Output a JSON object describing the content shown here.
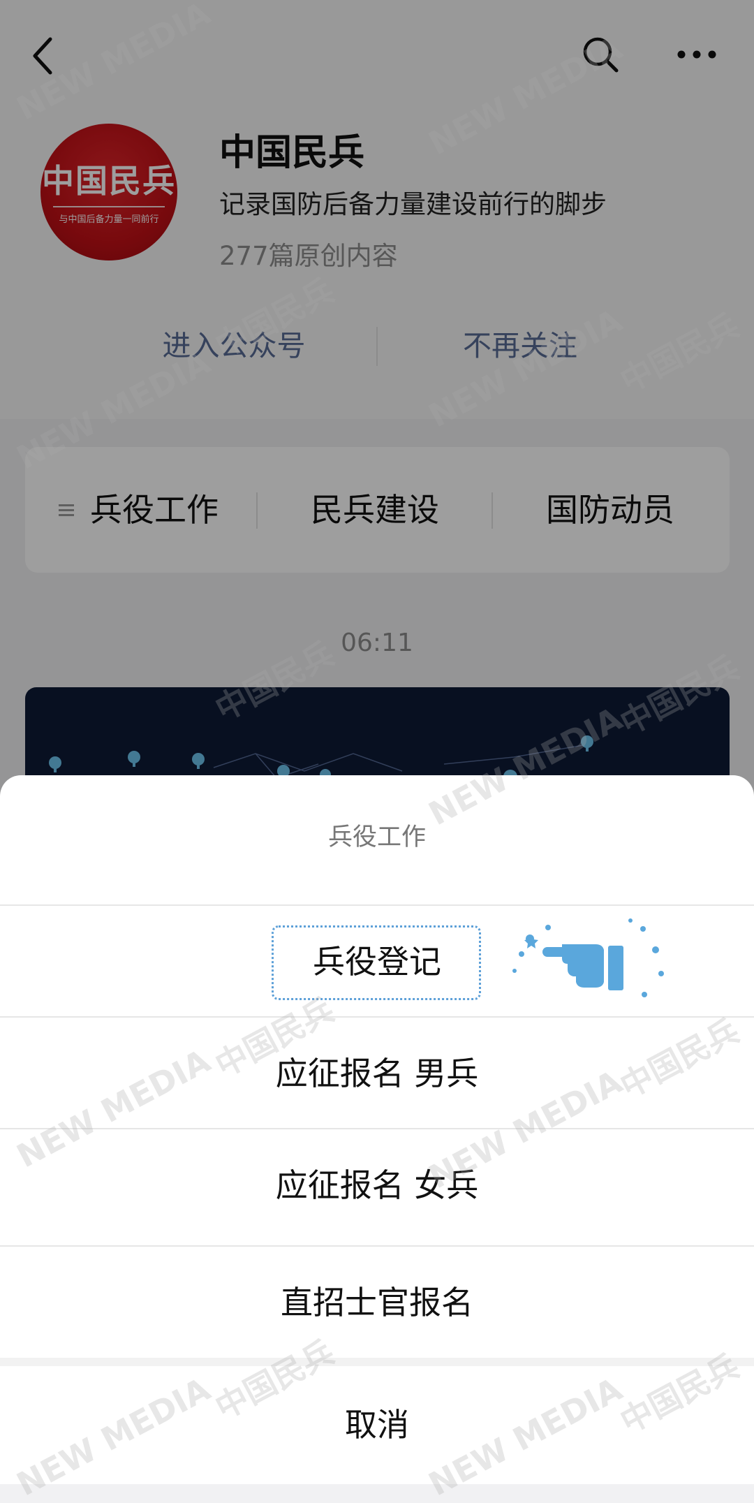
{
  "header": {
    "back_icon": "back-chevron-icon",
    "search_icon": "search-icon",
    "more_icon": "more-icon"
  },
  "account": {
    "avatar_logo_text": "中国民兵",
    "avatar_slogan": "与中国后备力量一同前行",
    "name": "中国民兵",
    "description": "记录国防后备力量建设前行的脚步",
    "original_count": "277篇原创内容"
  },
  "actions": {
    "enter": "进入公众号",
    "unfollow": "不再关注"
  },
  "menu": {
    "items": [
      {
        "label": "兵役工作"
      },
      {
        "label": "民兵建设"
      },
      {
        "label": "国防动员"
      }
    ]
  },
  "feed": {
    "timestamp": "06:11"
  },
  "sheet": {
    "title": "兵役工作",
    "options": [
      {
        "label": "兵役登记"
      },
      {
        "label": "应征报名 男兵"
      },
      {
        "label": "应征报名 女兵"
      },
      {
        "label": "直招士官报名"
      }
    ],
    "cancel": "取消"
  },
  "watermark": {
    "text_en": "NEW MEDIA",
    "text_cn": "中国民兵"
  },
  "colors": {
    "link_blue": "#576b95",
    "avatar_red": "#c21016",
    "highlight_blue": "#5da0d8"
  }
}
